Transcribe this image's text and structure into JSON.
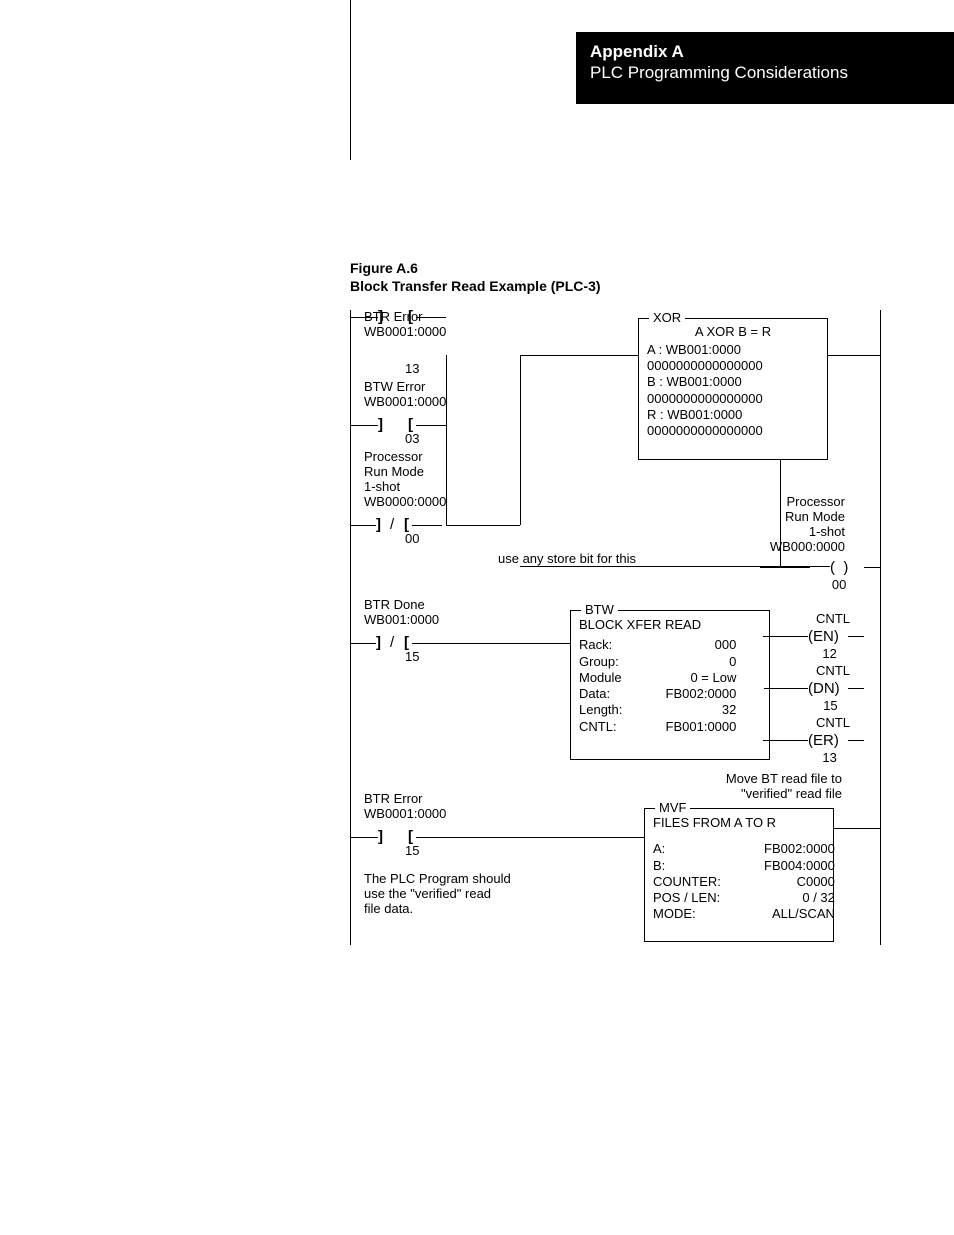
{
  "header": {
    "line1": "Appendix A",
    "line2": "PLC Programming Considerations"
  },
  "figcap": {
    "num": "Figure A.6",
    "title": "Block Transfer Read Example (PLC-3)"
  },
  "rung1": {
    "c1": {
      "lbl1": "BTR Error",
      "lbl2": "WB0001:0000",
      "bit": "13"
    },
    "c2": {
      "lbl1": "BTW Error",
      "lbl2": "WB0001:0000",
      "bit": "03"
    },
    "c3": {
      "lbl1": "Processor",
      "lbl2": "Run Mode",
      "lbl3": "1-shot",
      "lbl4": "WB0000:0000",
      "bit": "00"
    },
    "note": "use any store bit for this",
    "xor": {
      "title": "XOR",
      "eq": "A XOR B = R",
      "A": "A   :   WB001:0000",
      "Av": "0000000000000000",
      "B": "B   :   WB001:0000",
      "Bv": "0000000000000000",
      "R": "R   :   WB001:0000",
      "Rv": "0000000000000000"
    },
    "out": {
      "lbl1": "Processor",
      "lbl2": "Run Mode",
      "lbl3": "1-shot",
      "lbl4": "WB000:0000",
      "bit": "00"
    }
  },
  "rung2": {
    "c1": {
      "lbl1": "BTR Done",
      "lbl2": "WB001:0000",
      "bit": "15"
    },
    "btw": {
      "title": "BTW",
      "heading": "BLOCK XFER READ",
      "rack_l": "Rack:",
      "rack_v": "000",
      "group_l": "Group:",
      "group_v": "0",
      "mod_l": "Module",
      "mod_v": "0 = Low",
      "data_l": "Data:",
      "data_v": "FB002:0000",
      "len_l": "Length:",
      "len_v": "32",
      "cntl_l": "CNTL:",
      "cntl_v": "FB001:0000"
    },
    "en": {
      "top": "CNTL",
      "mid": "(EN)",
      "bit": "12"
    },
    "dn": {
      "top": "CNTL",
      "mid": "(DN)",
      "bit": "15"
    },
    "er": {
      "top": "CNTL",
      "mid": "(ER)",
      "bit": "13"
    }
  },
  "rung3": {
    "c1": {
      "lbl1": "BTR Error",
      "lbl2": "WB0001:0000",
      "bit": "15"
    },
    "note1": "The PLC Program should",
    "note2": "use the \"verified\" read",
    "note3": "file data.",
    "top1": "Move BT read file to",
    "top2": "\"verified\" read file",
    "mvf": {
      "title": "MVF",
      "heading": "FILES FROM A TO R",
      "a_l": "A:",
      "a_v": "FB002:0000",
      "b_l": "B:",
      "b_v": "FB004:0000",
      "cnt_l": "COUNTER:",
      "cnt_v": "C0000",
      "pos_l": "POS / LEN:",
      "pos_v": "0 / 32",
      "mode_l": "MODE:",
      "mode_v": "ALL/SCAN"
    }
  }
}
